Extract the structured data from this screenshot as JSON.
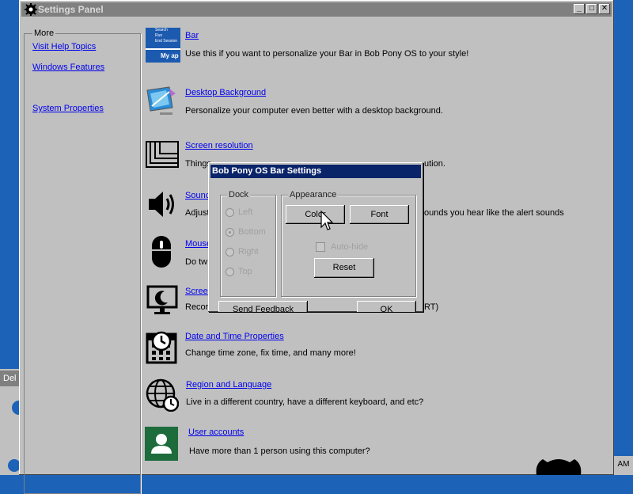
{
  "window": {
    "title": "Settings Panel",
    "controls": [
      "_",
      "□",
      "✕"
    ]
  },
  "sidebar": {
    "legend": "More",
    "links": [
      {
        "label": "Visit Help Topics"
      },
      {
        "label": "Windows Features"
      },
      {
        "label": "System Properties"
      }
    ]
  },
  "items": [
    {
      "title": "Bar",
      "desc": "Use this if you want to personalize your Bar in Bob Pony OS to your style!",
      "icon": "bar-icon",
      "icon_text": [
        "Search",
        "Run",
        "End Session",
        "My ap"
      ]
    },
    {
      "title": "Desktop Background",
      "desc": "Personalize your computer even better with a desktop background.",
      "icon": "desktop-background-icon"
    },
    {
      "title": "Screen resolution",
      "desc": "Things",
      "desc_tail": "ution.",
      "icon": "screen-resolution-icon"
    },
    {
      "title": "Sound",
      "title_visible": "Sounc",
      "desc": "Adjust",
      "desc_tail": "ounds you hear like the alert sounds",
      "icon": "speaker-icon"
    },
    {
      "title": "Mouse",
      "title_visible": "Mouse",
      "desc": "Do tw",
      "icon": "mouse-icon"
    },
    {
      "title": "Screen",
      "title_visible": "Scree",
      "desc": "Recor",
      "desc_tail": "RT)",
      "icon": "screensaver-icon"
    },
    {
      "title": "Date and Time Properties",
      "desc": "Change time zone, fix time, and many more!",
      "icon": "calendar-clock-icon"
    },
    {
      "title": "Region and Language",
      "desc": "Live in a different country, have a different keyboard, and etc?",
      "icon": "globe-clock-icon"
    },
    {
      "title": "User accounts",
      "desc": "Have more than 1 person using this computer?",
      "icon": "user-account-icon"
    }
  ],
  "dialog": {
    "title": "Bob Pony OS Bar Settings",
    "dock": {
      "legend": "Dock",
      "options": [
        {
          "label": "Left",
          "selected": false
        },
        {
          "label": "Bottom",
          "selected": true
        },
        {
          "label": "Right",
          "selected": false
        },
        {
          "label": "Top",
          "selected": false
        }
      ]
    },
    "appearance": {
      "legend": "Appearance",
      "color_label": "Color",
      "font_label": "Font",
      "autohide_label": "Auto-hide",
      "autohide_checked": false,
      "reset_label": "Reset"
    },
    "feedback_label": "Send Feedback",
    "ok_label": "OK"
  },
  "background_window": {
    "title": "Del"
  },
  "taskbar": {
    "clock": "AM"
  },
  "colors": {
    "link": "#0000ee",
    "dialog_title": "#0a246a",
    "window_title_inactive": "#808080",
    "desktop": "#1c63b8",
    "user_icon_bg": "#1e6b3c"
  }
}
